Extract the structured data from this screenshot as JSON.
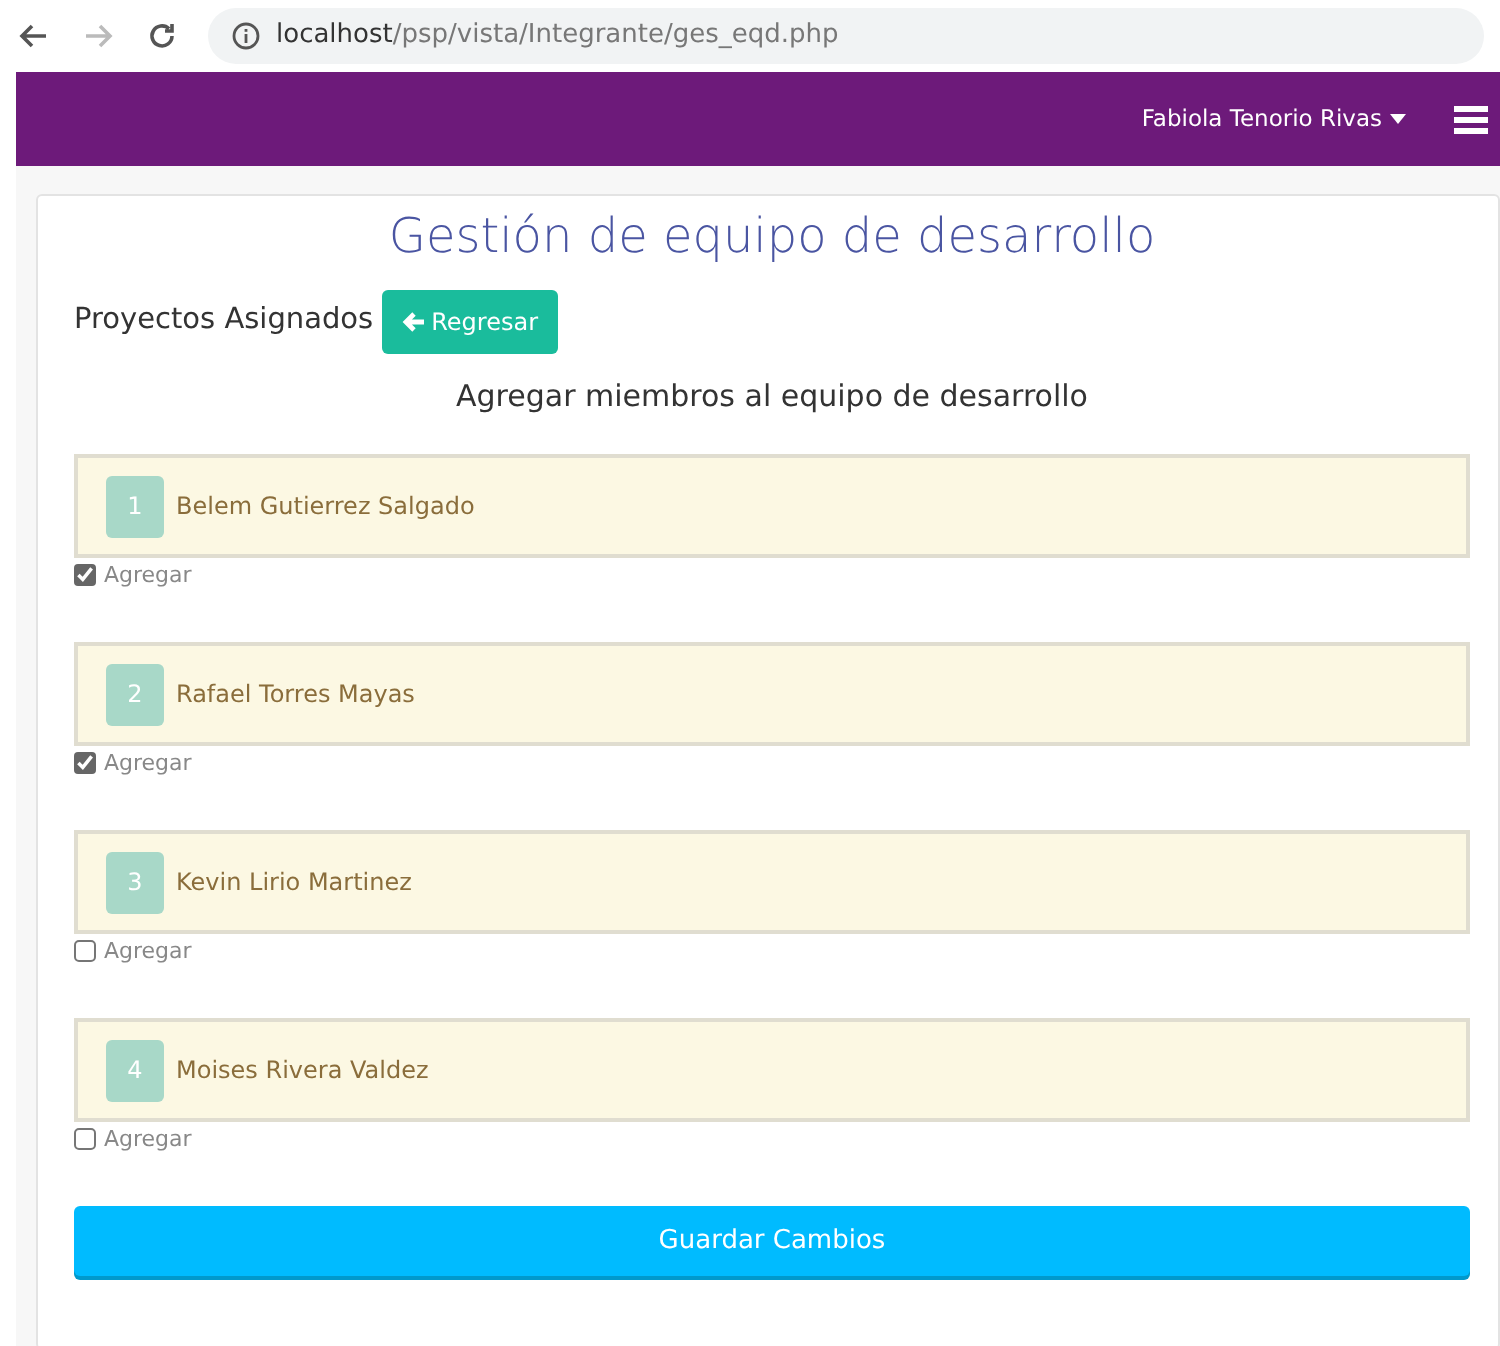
{
  "browser": {
    "url_host": "localhost",
    "url_path": "/psp/vista/Integrante/ges_eqd.php",
    "forward_disabled": true
  },
  "navbar": {
    "user": "Fabiola Tenorio Rivas"
  },
  "title": "Gestión de equipo de desarrollo",
  "projects_label": "Proyectos Asignados",
  "back_button": "Regresar",
  "subtitle": "Agregar miembros al equipo de desarrollo",
  "members": [
    {
      "number": "1",
      "name": "Belem Gutierrez Salgado",
      "checked": true,
      "check_label": "Agregar"
    },
    {
      "number": "2",
      "name": "Rafael Torres Mayas",
      "checked": true,
      "check_label": "Agregar"
    },
    {
      "number": "3",
      "name": "Kevin Lirio Martinez",
      "checked": false,
      "check_label": "Agregar"
    },
    {
      "number": "4",
      "name": "Moises Rivera Valdez",
      "checked": false,
      "check_label": "Agregar"
    }
  ],
  "save_button": "Guardar Cambios"
}
